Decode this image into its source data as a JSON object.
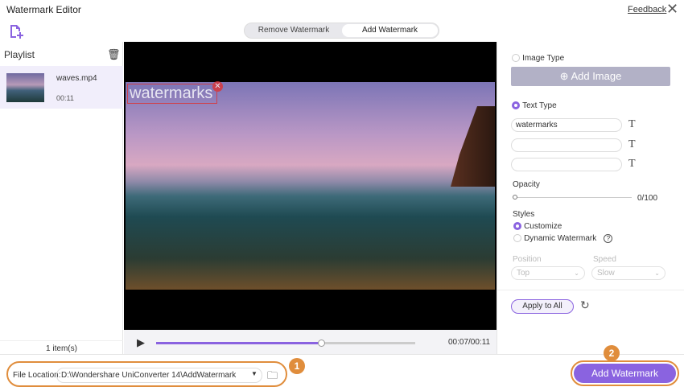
{
  "window": {
    "title": "Watermark Editor",
    "feedback": "Feedback",
    "close": "✕"
  },
  "tabs": [
    {
      "label": "Remove Watermark"
    },
    {
      "label": "Add Watermark",
      "active": true
    }
  ],
  "playlist": {
    "title": "Playlist",
    "items": [
      {
        "name": "waves.mp4",
        "duration": "00:11"
      }
    ],
    "count": "1 item(s)"
  },
  "preview": {
    "watermark_text": "watermarks",
    "current_time": "00:07/00:11",
    "progress": 0.636
  },
  "panel": {
    "image_type": "Image Type",
    "add_image": "Add Image",
    "text_type": "Text Type",
    "text_inputs": [
      "watermarks",
      "",
      ""
    ],
    "opacity_label": "Opacity",
    "opacity_value": "0/100",
    "styles_label": "Styles",
    "customize": "Customize",
    "dynamic": "Dynamic Watermark",
    "position_label": "Position",
    "position_value": "Top",
    "speed_label": "Speed",
    "speed_value": "Slow",
    "apply_all": "Apply to All"
  },
  "bottom": {
    "file_location_label": "File Location:",
    "file_location": "D:\\Wondershare UniConverter 14\\AddWatermark",
    "add_watermark": "Add Watermark",
    "badge1": "1",
    "badge2": "2"
  },
  "colors": {
    "accent": "#8a63e0",
    "highlight": "#e08d3c"
  }
}
